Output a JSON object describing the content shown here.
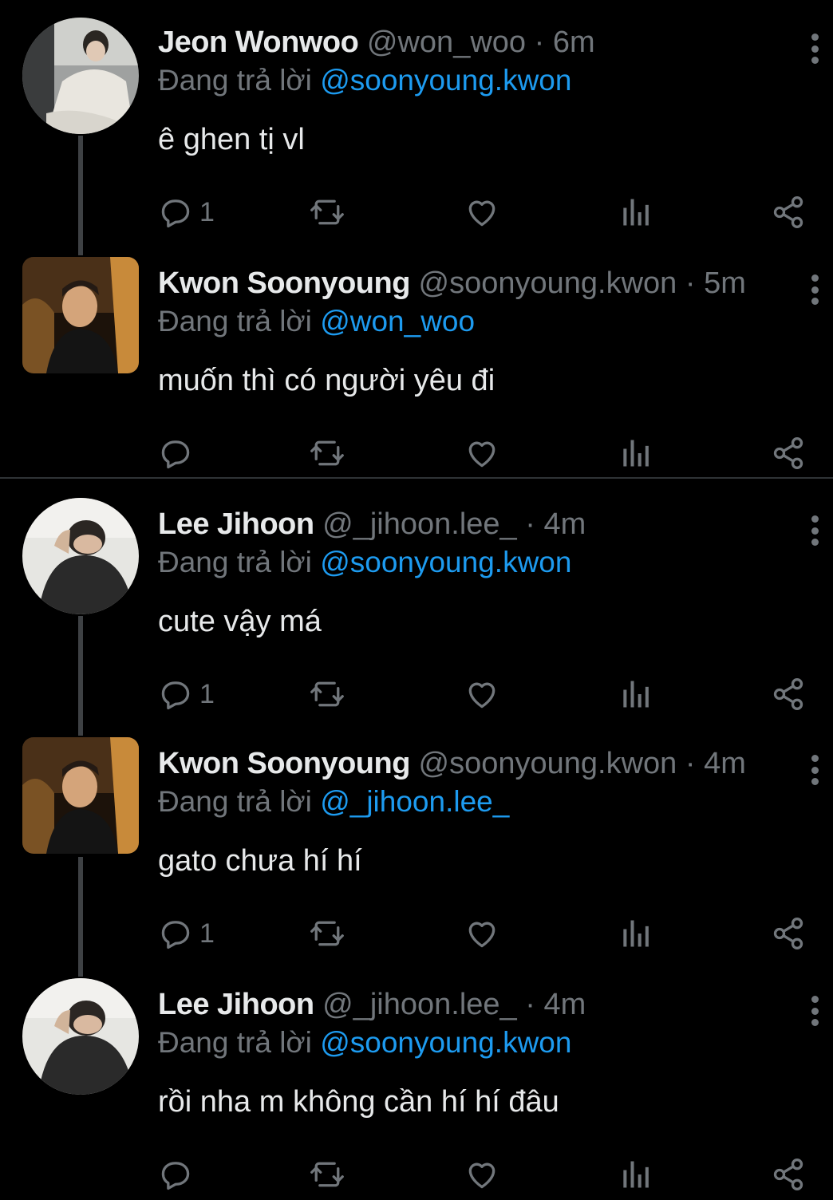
{
  "replying_prefix": "Đang trả lời",
  "colors": {
    "background": "#000000",
    "text": "#e7e9ea",
    "muted": "#71767b",
    "mention": "#1d9bf0"
  },
  "icons": [
    "comment-icon",
    "retweet-icon",
    "like-icon",
    "analytics-icon",
    "share-icon",
    "more-options-icon"
  ],
  "tweets": [
    {
      "name": "Jeon Wonwoo",
      "handle": "@won_woo",
      "time": "· 6m",
      "replying_to": "@soonyoung.kwon",
      "text": "ê ghen tị vl",
      "reply_count": "1"
    },
    {
      "name": "Kwon Soonyoung",
      "handle": "@soonyoung.kwon",
      "time": "· 5m",
      "replying_to": "@won_woo",
      "text": "muốn thì có người yêu đi",
      "reply_count": ""
    },
    {
      "name": "Lee Jihoon",
      "handle": "@_jihoon.lee_",
      "time": "· 4m",
      "replying_to": "@soonyoung.kwon",
      "text": "cute vậy má",
      "reply_count": "1"
    },
    {
      "name": "Kwon Soonyoung",
      "handle": "@soonyoung.kwon",
      "time": "· 4m",
      "replying_to": "@_jihoon.lee_",
      "text": "gato chưa hí hí",
      "reply_count": "1"
    },
    {
      "name": "Lee Jihoon",
      "handle": "@_jihoon.lee_",
      "time": "· 4m",
      "replying_to": "@soonyoung.kwon",
      "text": "rồi nha m không cần hí hí đâu",
      "reply_count": ""
    }
  ]
}
